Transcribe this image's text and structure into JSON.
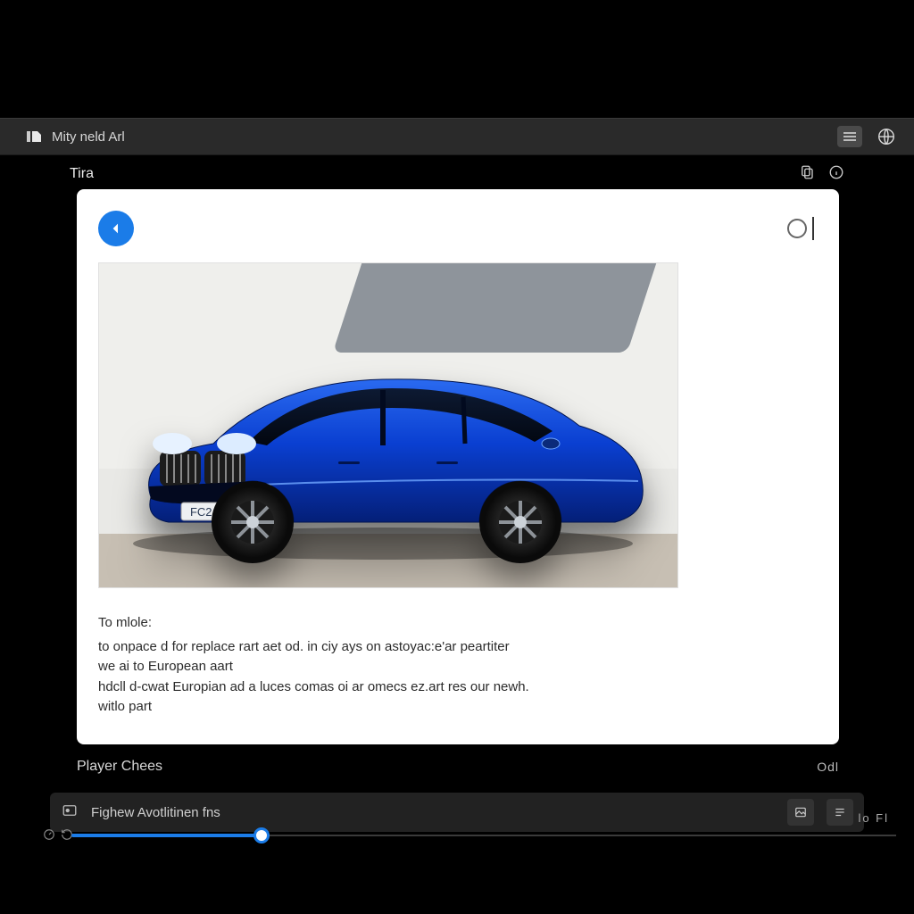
{
  "header": {
    "title": "Mity neld Arl",
    "menu_icon": "menu-icon",
    "globe_icon": "globe-icon"
  },
  "subheader": {
    "title": "Tira",
    "action1_icon": "copy-icon",
    "action2_icon": "info-icon"
  },
  "card": {
    "back_icon": "back-icon",
    "search_icon": "search-icon",
    "image_alt": "Blue European station wagon car",
    "license_plate": "FC2·0F",
    "article": {
      "lead": "To mlole:",
      "line1": "to onpace d for replace rart aet od. in ciy ays on astoyac:e'ar peartiter",
      "line2": "we ai to European aart",
      "line3": "hdcll d-cwat Europian ad a luces comas oi ar omecs ez.art res our newh.",
      "line4": "witlo part"
    }
  },
  "player_row": {
    "label": "Player Chees",
    "right": "Odl"
  },
  "player_bar": {
    "track_title": "Fighew Avotlitinen fns",
    "btn1_icon": "picture-icon",
    "btn2_icon": "queue-icon"
  },
  "time_right": "lo Fl",
  "progress": {
    "percent": 23
  },
  "colors": {
    "accent": "#1b7ce8",
    "car_blue": "#0a3fd1"
  }
}
